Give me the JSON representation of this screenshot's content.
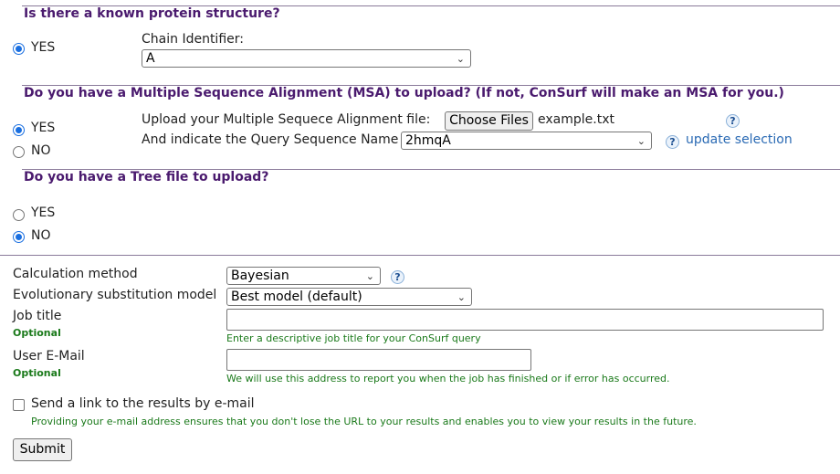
{
  "section_structure": {
    "heading": "Is there a known protein structure?",
    "yes_label": "YES",
    "chain_label": "Chain Identifier:",
    "chain_value": "A"
  },
  "section_msa": {
    "heading": "Do you have a Multiple Sequence Alignment (MSA) to upload? (If not, ConSurf will make an MSA for you.)",
    "yes_label": "YES",
    "no_label": "NO",
    "upload_label": "Upload your Multiple Sequece Alignment file:",
    "choose_files_label": "Choose Files",
    "file_name": "example.txt",
    "query_label": "And indicate the Query Sequence Name",
    "query_value": "2hmqA",
    "update_selection": "update selection"
  },
  "section_tree": {
    "heading": "Do you have a Tree file to upload?",
    "yes_label": "YES",
    "no_label": "NO"
  },
  "calc": {
    "method_label": "Calculation method",
    "method_value": "Bayesian",
    "model_label": "Evolutionary substitution model",
    "model_value": "Best model (default)",
    "job_title_label": "Job title",
    "optional1": "Optional",
    "job_title_hint": "Enter a descriptive job title for your ConSurf query",
    "email_label": "User E-Mail",
    "optional2": "Optional",
    "email_hint": "We will use this address to report you when the job has finished or if error has occurred.",
    "send_link_label": "Send a link to the results by e-mail",
    "send_link_hint": "Providing your e-mail address ensures that you don't lose the URL to your results and enables you to view your results in the future.",
    "submit_label": "Submit"
  },
  "icons": {
    "help": "?",
    "chevron": "⌄"
  }
}
